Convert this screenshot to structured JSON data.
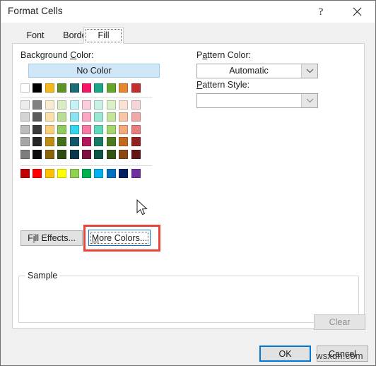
{
  "window": {
    "title": "Format Cells",
    "help_button": "?",
    "close_button": "×"
  },
  "tabs": [
    {
      "label": "Font",
      "active": false
    },
    {
      "label": "Border",
      "active": false
    },
    {
      "label": "Fill",
      "active": true
    }
  ],
  "background_color": {
    "label": "Background Color:",
    "label_prefix": "Background ",
    "label_accesskey": "C",
    "label_suffix": "olor:",
    "no_color_button": "No Color",
    "theme_colors": [
      "#ffffff",
      "#000000",
      "#f5b81c",
      "#5f9425",
      "#1c6b76",
      "#f7156a",
      "#1ba588",
      "#64a52a",
      "#e8852f",
      "#c32e2c"
    ],
    "tint_rows": [
      [
        "#ededed",
        "#818181",
        "#fbecd1",
        "#d9ecc4",
        "#c6f1f6",
        "#fccbdc",
        "#c9f2e7",
        "#dcf0c5",
        "#fbe2d2",
        "#f7d4d5"
      ],
      [
        "#d4d4d4",
        "#5b5b5b",
        "#fbdfa9",
        "#b9dd92",
        "#8ae3ef",
        "#fba7c3",
        "#9ae7d3",
        "#c3e59a",
        "#f7c7a7",
        "#efa9ab"
      ],
      [
        "#bcbcbc",
        "#3b3b3b",
        "#f9cf7e",
        "#8fcb5e",
        "#33d7eb",
        "#f87ba3",
        "#5fd9bb",
        "#a6d66f",
        "#f3ab7c",
        "#e87e7f"
      ],
      [
        "#a5a5a5",
        "#262626",
        "#c08d13",
        "#42701a",
        "#11576b",
        "#b3165c",
        "#167a64",
        "#4a7a1e",
        "#c46a20",
        "#92201f"
      ],
      [
        "#7d7d7d",
        "#0d0d0d",
        "#8b6309",
        "#2c4c12",
        "#09394a",
        "#7c0f3f",
        "#0e5444",
        "#325413",
        "#8a4815",
        "#631515"
      ]
    ],
    "standard_colors": [
      "#c00000",
      "#ff0000",
      "#ffc000",
      "#ffff00",
      "#92d050",
      "#00b050",
      "#00b0f0",
      "#0070c0",
      "#002060",
      "#7030a0"
    ]
  },
  "buttons": {
    "fill_effects": "Fill Effects...",
    "fill_effects_prefix": "F",
    "fill_effects_accesskey": "i",
    "fill_effects_suffix": "ll Effects...",
    "more_colors": "More Colors...",
    "more_colors_accesskey": "M",
    "more_colors_suffix": "ore Colors...",
    "clear": "Clear",
    "ok": "OK",
    "cancel": "Cancel"
  },
  "pattern": {
    "color_label": "Pattern Color:",
    "color_label_prefix": "P",
    "color_label_accesskey": "a",
    "color_label_suffix": "ttern Color:",
    "color_value": "Automatic",
    "style_label": "Pattern Style:",
    "style_label_accesskey": "P",
    "style_label_suffix": "attern Style:",
    "style_value": ""
  },
  "sample": {
    "legend": "Sample",
    "content": ""
  },
  "annotation": {
    "highlight_target": "more-colors-button",
    "highlight_color": "#e8443a"
  },
  "watermark": {
    "text": "wsxdn.com"
  }
}
